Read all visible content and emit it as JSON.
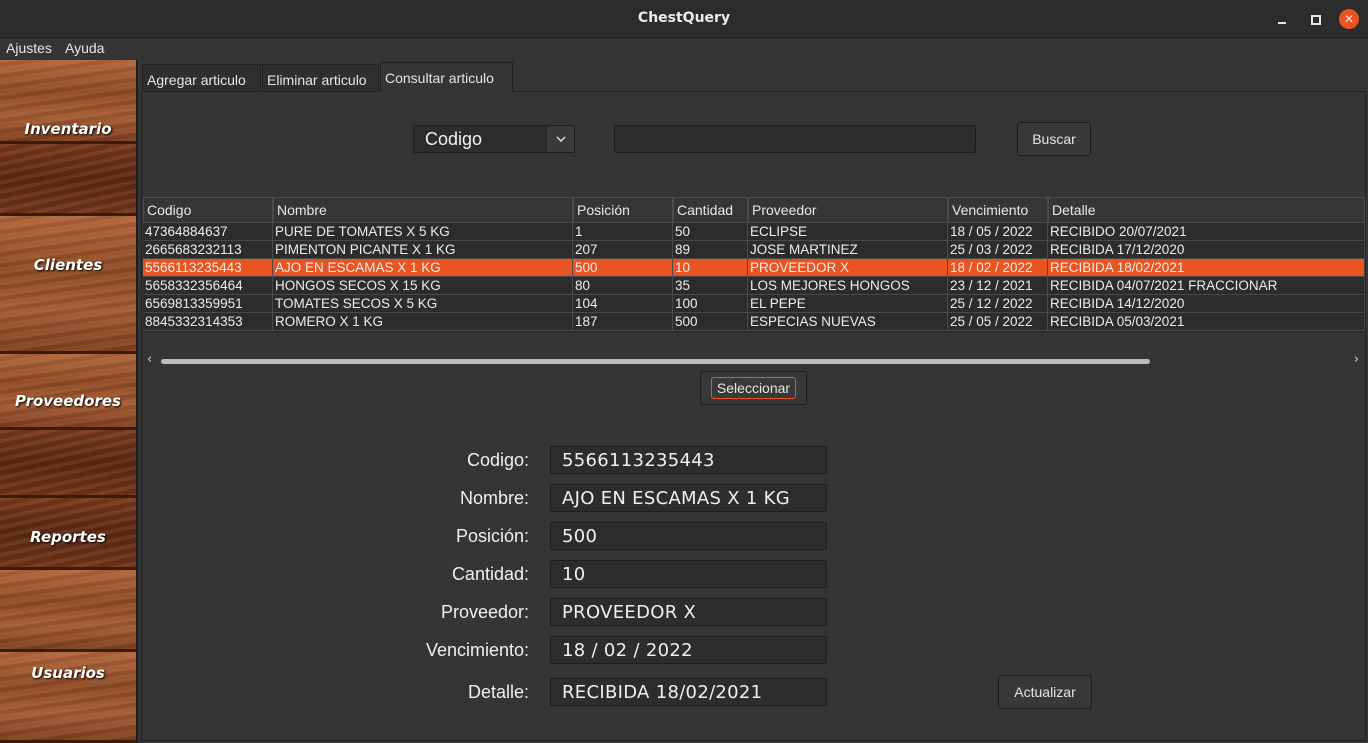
{
  "window": {
    "title": "ChestQuery",
    "close_glyph": "✕"
  },
  "menu": [
    "Ajustes",
    "Ayuda"
  ],
  "sidebar": [
    "Inventario",
    "Clientes",
    "Proveedores",
    "Reportes",
    "Usuarios"
  ],
  "tabs": [
    "Agregar articulo",
    "Eliminar articulo",
    "Consultar articulo"
  ],
  "search": {
    "field": "Codigo",
    "query": "",
    "button": "Buscar",
    "dropdown_icon": "chevron-down-icon"
  },
  "table": {
    "columns": [
      "Codigo",
      "Nombre",
      "Posición",
      "Cantidad",
      "Proveedor",
      "Vencimiento",
      "Detalle"
    ],
    "rows": [
      [
        "47364884637",
        "PURE DE TOMATES X 5 KG",
        "1",
        "50",
        "ECLIPSE",
        "18 / 05 / 2022",
        "RECIBIDO 20/07/2021"
      ],
      [
        "2665683232113",
        "PIMENTON PICANTE X 1 KG",
        "207",
        "89",
        "JOSE MARTINEZ",
        "25 / 03 / 2022",
        "RECIBIDA 17/12/2020"
      ],
      [
        "5566113235443",
        "AJO EN ESCAMAS X 1 KG",
        "500",
        "10",
        "PROVEEDOR X",
        "18 / 02 / 2022",
        "RECIBIDA 18/02/2021"
      ],
      [
        "5658332356464",
        "HONGOS SECOS X 15 KG",
        "80",
        "35",
        "LOS MEJORES HONGOS",
        "23 / 12 / 2021",
        "RECIBIDA 04/07/2021 FRACCIONAR"
      ],
      [
        "6569813359951",
        "TOMATES SECOS X 5 KG",
        "104",
        "100",
        "EL PEPE",
        "25 / 12 / 2022",
        "RECIBIDA 14/12/2020"
      ],
      [
        "8845332314353",
        "ROMERO X 1 KG",
        "187",
        "500",
        "ESPECIAS NUEVAS",
        "25 / 05 / 2022",
        "RECIBIDA 05/03/2021"
      ]
    ],
    "selected_row": 2,
    "scroll_fraction": 0.83,
    "scroll_left": "‹",
    "scroll_right": "›"
  },
  "select_button": "Seleccionar",
  "form": {
    "labels": [
      "Codigo:",
      "Nombre:",
      "Posición:",
      "Cantidad:",
      "Proveedor:",
      "Vencimiento:",
      "Detalle:"
    ],
    "values": [
      "5566113235443",
      "AJO EN ESCAMAS X 1 KG",
      "500",
      "10",
      "PROVEEDOR X",
      "18 / 02 / 2022",
      "RECIBIDA 18/02/2021"
    ]
  },
  "update_button": "Actualizar",
  "colors": {
    "accent": "#e95420",
    "background": "#353535"
  }
}
